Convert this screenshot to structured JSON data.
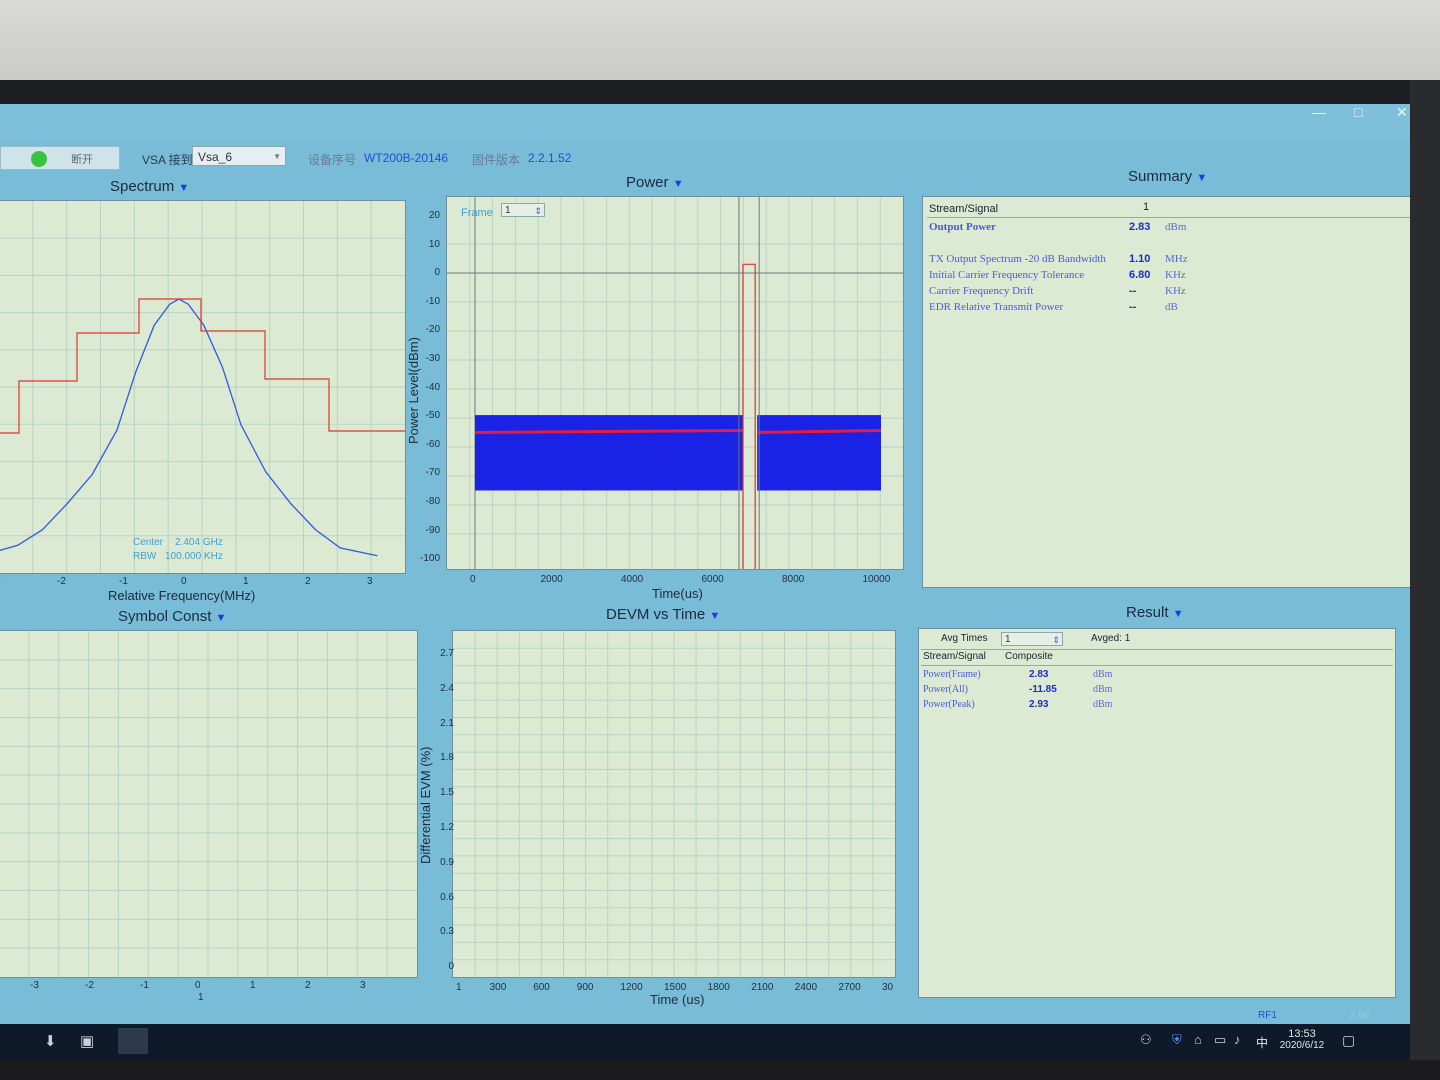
{
  "window": {
    "minimize_glyph": "—",
    "maximize_glyph": "□",
    "close_glyph": "✕"
  },
  "toolbar": {
    "status_text": "断开",
    "vsa_label": "VSA 接到",
    "vsa_value": "Vsa_6",
    "device_label": "设备序号",
    "device_value": "WT200B-20146",
    "firmware_label": "固件版本",
    "firmware_value": "2.2.1.52"
  },
  "spectrum": {
    "title": "Spectrum",
    "xlabel": "Relative Frequency(MHz)",
    "xticks": [
      "3",
      "-2",
      "-1",
      "0",
      "1",
      "2",
      "3"
    ],
    "center_label": "Center",
    "center_value": "2.404 GHz",
    "rbw_label": "RBW",
    "rbw_value": "100.000 KHz"
  },
  "power": {
    "title": "Power",
    "frame_label": "Frame",
    "frame_value": "1",
    "xlabel": "Time(us)",
    "ylabel": "Power Level(dBm)",
    "yticks": [
      "20",
      "10",
      "0",
      "-10",
      "-20",
      "-30",
      "-40",
      "-50",
      "-60",
      "-70",
      "-80",
      "-90",
      "-100"
    ],
    "xticks": [
      "0",
      "2000",
      "4000",
      "6000",
      "8000",
      "10000"
    ]
  },
  "summary": {
    "title": "Summary",
    "col_header": "Stream/Signal",
    "col_value": "1",
    "rows": [
      {
        "label": "Output Power",
        "value": "2.83",
        "unit": "dBm"
      },
      {
        "label": "TX Output Spectrum -20 dB Bandwidth",
        "value": "1.10",
        "unit": "MHz"
      },
      {
        "label": "Initial Carrier Frequency Tolerance",
        "value": "6.80",
        "unit": "KHz"
      },
      {
        "label": "Carrier Frequency Drift",
        "value": "--",
        "unit": "KHz"
      },
      {
        "label": "EDR Relative Transmit Power",
        "value": "--",
        "unit": "dB"
      }
    ]
  },
  "symbol": {
    "title": "Symbol Const",
    "xticks": [
      "-3",
      "-2",
      "-1",
      "0",
      "1",
      "2",
      "3"
    ],
    "sub_tick": "1"
  },
  "devm": {
    "title": "DEVM vs Time",
    "xlabel": "Time (us)",
    "ylabel": "Differential EVM (%)",
    "yticks": [
      "2.7",
      "2.4",
      "2.1",
      "1.8",
      "1.5",
      "1.2",
      "0.9",
      "0.6",
      "0.3",
      "0"
    ],
    "xticks": [
      "1",
      "300",
      "600",
      "900",
      "1200",
      "1500",
      "1800",
      "2100",
      "2400",
      "2700",
      "30"
    ]
  },
  "result": {
    "title": "Result",
    "avg_label": "Avg Times",
    "avg_value": "1",
    "avged_label": "Avged: 1",
    "col_header": "Stream/Signal",
    "col_value": "Composite",
    "rows": [
      {
        "label": "Power(Frame)",
        "value": "2.83",
        "unit": "dBm"
      },
      {
        "label": "Power(All)",
        "value": "-11.85",
        "unit": "dBm"
      },
      {
        "label": "Power(Peak)",
        "value": "2.93",
        "unit": "dBm"
      }
    ]
  },
  "statusbar": {
    "port": "RF1",
    "text": "2.96"
  },
  "taskbar": {
    "time": "13:53",
    "date": "2020/6/12",
    "ime": "中"
  },
  "chart_data": [
    {
      "type": "line",
      "title": "Spectrum",
      "xlabel": "Relative Frequency(MHz)",
      "xlim": [
        -3,
        3
      ],
      "series": [
        {
          "values_x": [
            -3.2,
            -2.6,
            -2.2,
            -1.8,
            -1.4,
            -1.0,
            -0.7,
            -0.4,
            -0.15,
            0.0,
            0.15,
            0.4,
            0.7,
            1.0,
            1.4,
            1.8,
            2.2,
            2.6,
            3.2
          ],
          "values_y": [
            0.02,
            0.06,
            0.12,
            0.22,
            0.33,
            0.5,
            0.72,
            0.9,
            0.98,
            1.0,
            0.98,
            0.9,
            0.74,
            0.52,
            0.34,
            0.22,
            0.12,
            0.05,
            0.02
          ]
        }
      ]
    },
    {
      "type": "area",
      "title": "Power",
      "xlabel": "Time(us)",
      "ylabel": "Power Level(dBm)",
      "xlim": [
        0,
        10000
      ],
      "ylim": [
        -100,
        20
      ],
      "segments": [
        {
          "x_start": 0,
          "x_end": 6600,
          "env_top": -49,
          "env_bottom": -75,
          "mean": -55
        },
        {
          "x_start": 6950,
          "x_end": 10000,
          "env_top": -49,
          "env_bottom": -75,
          "mean": -55
        }
      ],
      "burst": {
        "x_start": 6600,
        "x_end": 6950,
        "level": 3
      }
    }
  ]
}
